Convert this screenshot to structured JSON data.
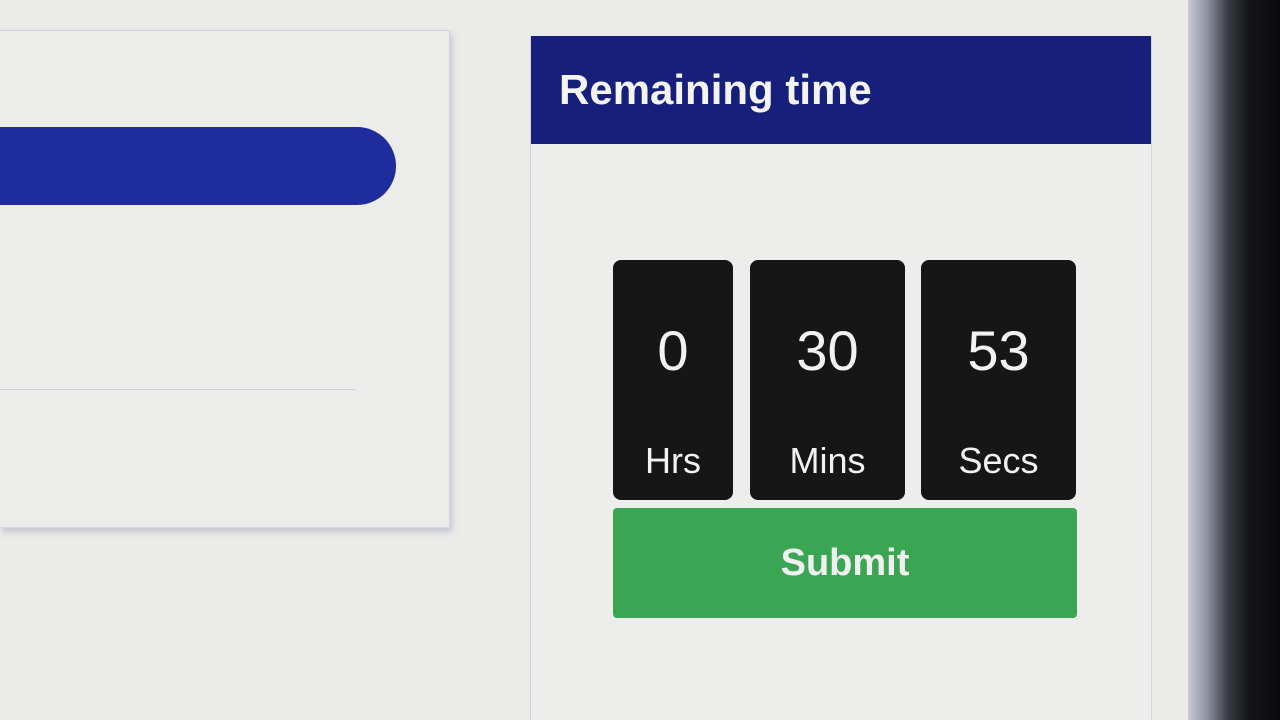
{
  "timer": {
    "title": "Remaining time",
    "units": [
      {
        "value": "0",
        "label": "Hrs"
      },
      {
        "value": "30",
        "label": "Mins"
      },
      {
        "value": "53",
        "label": "Secs"
      }
    ],
    "submit_label": "Submit"
  },
  "colors": {
    "header_bg": "#16207a",
    "progress_fill": "#1f2c9c",
    "box_bg": "#161616",
    "submit_bg": "#3aa553"
  }
}
